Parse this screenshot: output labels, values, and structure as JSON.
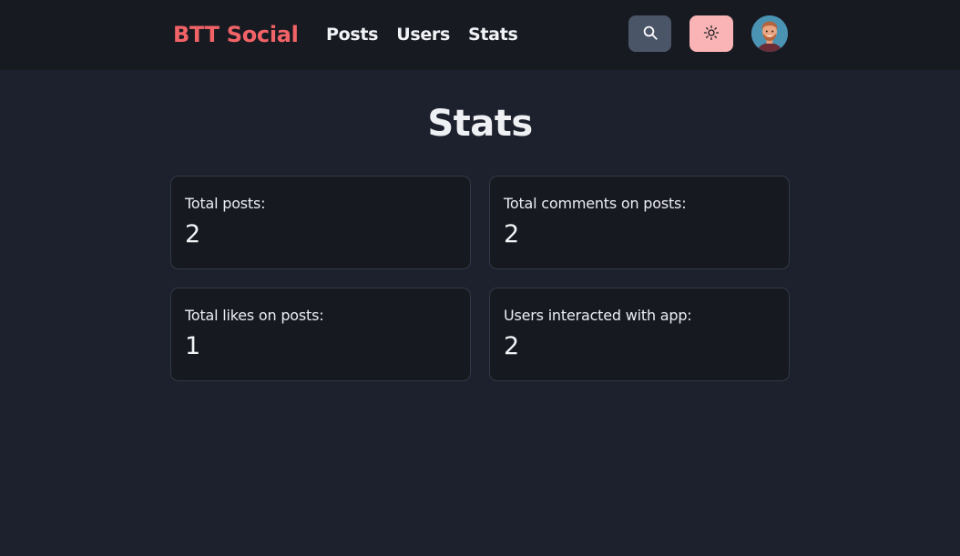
{
  "navbar": {
    "brand": "BTT Social",
    "links": [
      {
        "label": "Posts"
      },
      {
        "label": "Users"
      },
      {
        "label": "Stats"
      }
    ],
    "search_icon": "search-icon",
    "theme_icon": "sun-icon",
    "avatar_icon": "user-avatar"
  },
  "main": {
    "title": "Stats",
    "cards": [
      {
        "label": "Total posts:",
        "value": "2"
      },
      {
        "label": "Total comments on posts:",
        "value": "2"
      },
      {
        "label": "Total likes on posts:",
        "value": "1"
      },
      {
        "label": "Users interacted with app:",
        "value": "2"
      }
    ]
  },
  "colors": {
    "background": "#1d212d",
    "navbar": "#181a22",
    "brand": "#f26367",
    "search_button": "#4b5568",
    "theme_button": "#fbb4b5",
    "card_background": "#171920",
    "card_border": "#333846"
  }
}
